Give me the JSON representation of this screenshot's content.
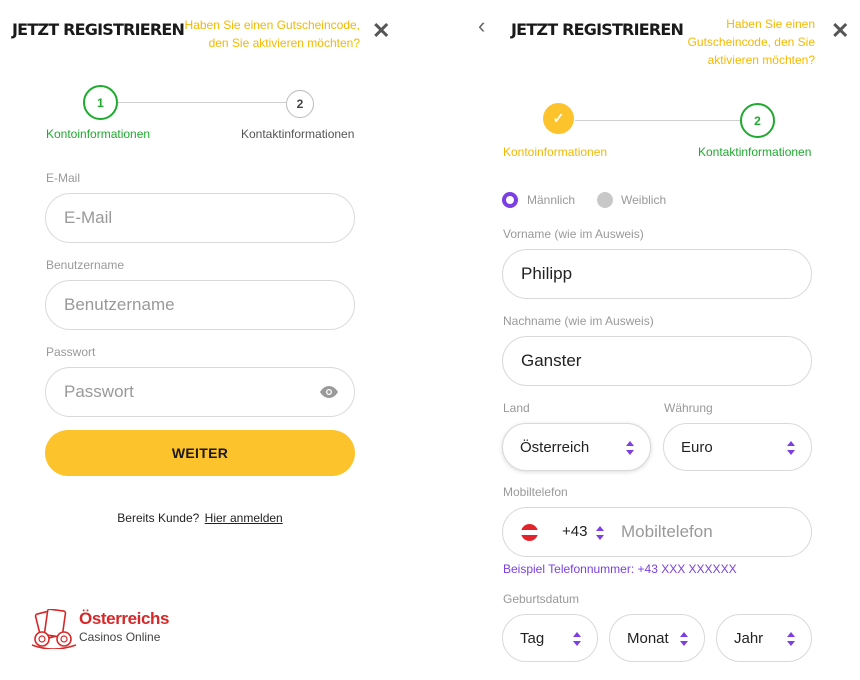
{
  "left": {
    "title": "JETZT REGISTRIEREN",
    "voucher_line1": "Haben Sie einen Gutscheincode,",
    "voucher_line2": "den Sie aktivieren möchten?",
    "close_icon": "✕",
    "steps": [
      {
        "number": "1",
        "label": "Kontoinformationen"
      },
      {
        "number": "2",
        "label": "Kontaktinformationen"
      }
    ],
    "email": {
      "label": "E-Mail",
      "placeholder": "E-Mail"
    },
    "username": {
      "label": "Benutzername",
      "placeholder": "Benutzername"
    },
    "password": {
      "label": "Passwort",
      "placeholder": "Passwort"
    },
    "next_button": "WEITER",
    "existing_customer": "Bereits Kunde?",
    "login_link": "Hier anmelden",
    "logo_title": "Österreichs",
    "logo_subtitle": "Casinos Online"
  },
  "right": {
    "back_icon": "‹",
    "title": "JETZT REGISTRIEREN",
    "voucher_line1": "Haben Sie einen",
    "voucher_line2": "Gutscheincode, den Sie",
    "voucher_line3": "aktivieren möchten?",
    "close_icon": "✕",
    "steps": [
      {
        "number": "✓",
        "label": "Kontoinformationen"
      },
      {
        "number": "2",
        "label": "Kontaktinformationen"
      }
    ],
    "gender_male": "Männlich",
    "gender_female": "Weiblich",
    "firstname": {
      "label": "Vorname (wie im Ausweis)",
      "value": "Philipp"
    },
    "lastname": {
      "label": "Nachname (wie im Ausweis)",
      "value": "Ganster"
    },
    "country": {
      "label": "Land",
      "value": "Österreich"
    },
    "currency": {
      "label": "Währung",
      "value": "Euro"
    },
    "phone": {
      "label": "Mobiltelefon",
      "prefix": "+43",
      "placeholder": "Mobiltelefon"
    },
    "phone_hint": "Beispiel Telefonnummer: +43 XXX XXXXXX",
    "birthdate": {
      "label": "Geburtsdatum",
      "day": "Tag",
      "month": "Monat",
      "year": "Jahr"
    }
  },
  "colors": {
    "accent_yellow": "#fdc32d",
    "step_green": "#1faa2f",
    "purple": "#7b3fe4"
  }
}
